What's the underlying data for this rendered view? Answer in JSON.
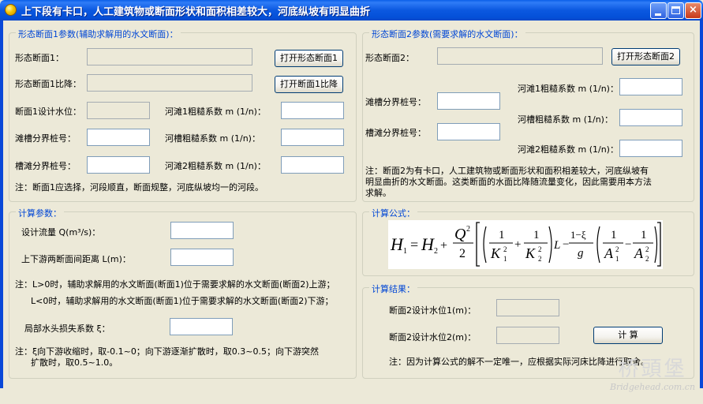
{
  "window": {
    "title": "上下段有卡口，人工建筑物或断面形状和面积相差较大，河底纵坡有明显曲折",
    "buttons": {
      "minimize": "",
      "maximize": "",
      "close": "×"
    }
  },
  "section1": {
    "legend": "形态断面1参数(辅助求解用的水文断面)：",
    "shape_label": "形态断面1：",
    "shape_value": "",
    "open_shape_button": "打开形态断面1",
    "slope_label": "形态断面1比降：",
    "slope_value": "",
    "open_slope_button": "打开断面1比降",
    "design_level_label": "断面1设计水位：",
    "design_level_value": "",
    "beach1_rough_label": "河滩1粗糙系数 m (1/n)：",
    "beach1_rough_value": "",
    "beach_channel_stake_label": "滩槽分界桩号：",
    "beach_channel_stake_value": "",
    "channel_rough_label": "河槽粗糙系数 m (1/n)：",
    "channel_rough_value": "",
    "channel_beach_stake_label": "槽滩分界桩号：",
    "channel_beach_stake_value": "",
    "beach2_rough_label": "河滩2粗糙系数 m (1/n)：",
    "beach2_rough_value": "",
    "note": "注：断面1应选择，河段顺直，断面规整，河底纵坡均一的河段。"
  },
  "section2": {
    "legend": "形态断面2参数(需要求解的水文断面)：",
    "shape_label": "形态断面2：",
    "shape_value": "",
    "open_shape_button": "打开形态断面2",
    "beach1_rough_label": "河滩1粗糙系数 m (1/n)：",
    "beach1_rough_value": "",
    "beach_channel_stake_label": "滩槽分界桩号：",
    "beach_channel_stake_value": "",
    "channel_rough_label": "河槽粗糙系数 m (1/n)：",
    "channel_rough_value": "",
    "channel_beach_stake_label": "槽滩分界桩号：",
    "channel_beach_stake_value": "",
    "beach2_rough_label": "河滩2粗糙系数 m (1/n)：",
    "beach2_rough_value": "",
    "note_lines": [
      "注：断面2为有卡口，人工建筑物或断面形状和面积相差较大，河底纵坡有",
      "明显曲折的水文断面。这类断面的水面比降随流量变化，因此需要用本方法",
      "求解。"
    ]
  },
  "calc_params": {
    "legend": "计算参数：",
    "flow_label": "设计流量 Q(m³/s)：",
    "flow_value": "",
    "distance_label": "上下游两断面间距离 L(m)：",
    "distance_value": "",
    "note_l_lines": [
      "注：L>0时，辅助求解用的水文断面(断面1)位于需要求解的水文断面(断面2)上游；",
      "L<0时，辅助求解用的水文断面(断面1)位于需要求解的水文断面(断面2)下游；"
    ],
    "loss_label": "局部水头损失系数 ξ：",
    "loss_value": "",
    "note_xi_lines": [
      "注：ξ向下游收缩时，取-0.1~0；向下游逐渐扩散时，取0.3~0.5；向下游突然",
      "扩散时，取0.5~1.0。"
    ]
  },
  "formula": {
    "legend": "计算公式：",
    "H1": "H",
    "sub1": "1",
    "eq": "=",
    "H2": "H",
    "sub2": "2",
    "plus": "+",
    "Q": "Q",
    "sq": "2",
    "two": "2",
    "one": "1",
    "K": "K",
    "subK1": "1",
    "subK2": "2",
    "L": "L",
    "minus": "−",
    "one_minus_xi": "1−ξ",
    "g": "g",
    "A": "A",
    "subA1": "1",
    "subA2": "2"
  },
  "results": {
    "legend": "计算结果：",
    "level1_label": "断面2设计水位1(m)：",
    "level1_value": "",
    "level2_label": "断面2设计水位2(m)：",
    "level2_value": "",
    "calc_button": "计 算",
    "note": "注：因为计算公式的解不一定唯一，应根据实际河床比降进行取舍。"
  },
  "watermark": {
    "cn": "桥頭堡",
    "url": "Bridgehead.com.cn"
  }
}
